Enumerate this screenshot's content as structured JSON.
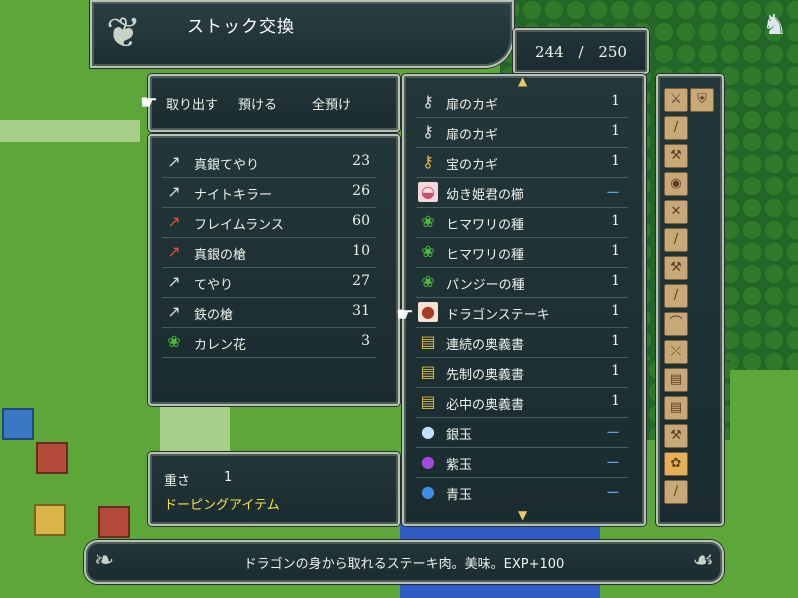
{
  "title": "ストック交換",
  "counter": {
    "current": "244",
    "max": "250",
    "separator": "/"
  },
  "commands": [
    "取り出す",
    "預ける",
    "全預け"
  ],
  "inventory": [
    {
      "name": "真銀てやり",
      "qty": "23",
      "icon": "lance-icon"
    },
    {
      "name": "ナイトキラー",
      "qty": "26",
      "icon": "lance-icon"
    },
    {
      "name": "フレイムランス",
      "qty": "60",
      "icon": "flame-lance-icon"
    },
    {
      "name": "真銀の槍",
      "qty": "10",
      "icon": "lance-icon"
    },
    {
      "name": "てやり",
      "qty": "27",
      "icon": "lance-icon"
    },
    {
      "name": "鉄の槍",
      "qty": "31",
      "icon": "lance-icon"
    },
    {
      "name": "カレン花",
      "qty": "3",
      "icon": "herb-icon"
    }
  ],
  "info": {
    "weight_label": "重さ",
    "weight_value": "1",
    "category": "ドーピングアイテム"
  },
  "stock": [
    {
      "name": "扉のカギ",
      "qty": "1",
      "icon": "key-icon"
    },
    {
      "name": "扉のカギ",
      "qty": "1",
      "icon": "key-icon"
    },
    {
      "name": "宝のカギ",
      "qty": "1",
      "icon": "treasure-key-icon"
    },
    {
      "name": "幼き姫君の櫛",
      "qty": "ー",
      "icon": "comb-icon"
    },
    {
      "name": "ヒマワリの種",
      "qty": "1",
      "icon": "herb-icon"
    },
    {
      "name": "ヒマワリの種",
      "qty": "1",
      "icon": "herb-icon"
    },
    {
      "name": "パンジーの種",
      "qty": "1",
      "icon": "herb-icon"
    },
    {
      "name": "ドラゴンステーキ",
      "qty": "1",
      "icon": "steak-icon"
    },
    {
      "name": "連続の奥義書",
      "qty": "1",
      "icon": "book-icon"
    },
    {
      "name": "先制の奥義書",
      "qty": "1",
      "icon": "book-icon"
    },
    {
      "name": "必中の奥義書",
      "qty": "1",
      "icon": "book-icon"
    },
    {
      "name": "銀玉",
      "qty": "ー",
      "icon": "silver-orb-icon"
    },
    {
      "name": "紫玉",
      "qty": "ー",
      "icon": "purple-orb-icon"
    },
    {
      "name": "青玉",
      "qty": "ー",
      "icon": "blue-orb-icon"
    }
  ],
  "help": "ドラゴンの身から取れるステーキ肉。美味。EXP+100",
  "colors": {
    "panel": "#1f3236",
    "border": "#b9c2b6",
    "category_yellow": "#f4e24a",
    "dash_blue": "#5aa3e0"
  }
}
